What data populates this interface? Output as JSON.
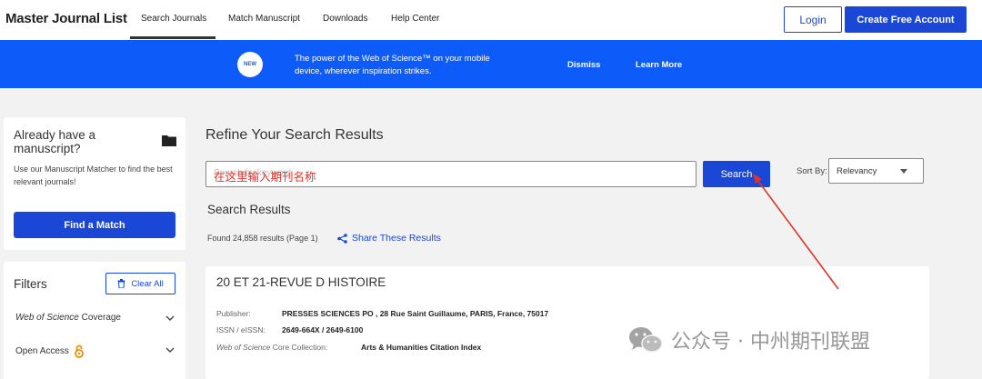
{
  "header": {
    "logo": "Master Journal List",
    "nav": [
      "Search Journals",
      "Match Manuscript",
      "Downloads",
      "Help Center"
    ],
    "login_label": "Login",
    "create_account_label": "Create Free Account"
  },
  "banner": {
    "badge": "NEW",
    "text": "The power of the Web of Science™ on your mobile device, wherever inspiration strikes.",
    "dismiss_label": "Dismiss",
    "learn_more_label": "Learn More"
  },
  "sidebar": {
    "manuscript_title": "Already have a manuscript?",
    "manuscript_desc": "Use our Manuscript Matcher to find the best relevant journals!",
    "find_match_label": "Find a Match",
    "filters_title": "Filters",
    "clear_all_label": "Clear All",
    "filter_items": [
      {
        "italic": "Web of Science",
        "rest": " Coverage"
      },
      {
        "italic": "",
        "rest": "Open Access"
      }
    ]
  },
  "main": {
    "refine_title": "Refine Your Search Results",
    "search_placeholder": "Search by keyword...",
    "search_annotation": "在这里输入期刊名称",
    "search_button_label": "Search",
    "sort_by_label": "Sort By:",
    "sort_value": "Relevancy",
    "results_title": "Search Results",
    "results_count": "Found 24,858 results (Page 1)",
    "share_label": "Share These Results"
  },
  "result": {
    "title": "20 ET 21-REVUE D HISTOIRE",
    "publisher_label": "Publisher:",
    "publisher": "PRESSES SCIENCES PO , 28 Rue Saint Guillaume, PARIS, France, 75017",
    "issn_label": "ISSN / eISSN:",
    "issn": "2649-664X / 2649-6100",
    "collection_label_italic": "Web of Science",
    "collection_label_rest": " Core Collection:",
    "collection": "Arts & Humanities Citation Index"
  },
  "watermark": {
    "text": "公众号 · 中州期刊联盟"
  },
  "colors": {
    "accent": "#1a47d6",
    "banner": "#0d5cf9",
    "annotation": "#e0342b",
    "page_bg": "#f2f2f2"
  }
}
